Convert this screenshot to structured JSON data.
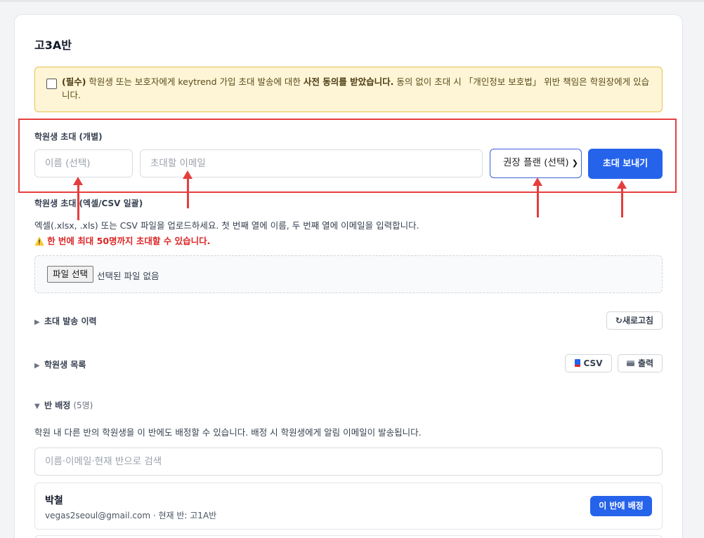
{
  "page": {
    "title": "고3A반"
  },
  "consent": {
    "checked": false,
    "required_tag": "(필수)",
    "text_a": " 학원생 또는 보호자에게 keytrend 가입 초대 발송에 대한 ",
    "text_bold": "사전 동의를 받았습니다.",
    "text_b": " 동의 없이 초대 시 「개인정보 보호법」 위반 책임은 학원장에게 있습니다."
  },
  "invite_single": {
    "label": "학원생 초대 (개별)",
    "name_placeholder": "이름 (선택)",
    "email_placeholder": "초대할 이메일",
    "plan_select_value": "권장 플랜 (선택)",
    "send_button": "초대 보내기"
  },
  "invite_bulk": {
    "label": "학원생 초대 (엑셀/CSV 일괄)",
    "description": "엑셀(.xlsx, .xls) 또는 CSV 파일을 업로드하세요. 첫 번째 열에 이름, 두 번째 열에 이메일을 입력합니다.",
    "warning_icon": "⚠️",
    "warning": "한 번에 최대 50명까지 초대할 수 있습니다.",
    "file_button": "파일 선택",
    "file_status": "선택된 파일 없음"
  },
  "history": {
    "label": "초대 발송 이력",
    "expanded": false,
    "refresh_button": "새로고침",
    "refresh_icon": "↻"
  },
  "students": {
    "label": "학원생 목록",
    "expanded": false,
    "csv_button": "CSV",
    "print_button": "출력"
  },
  "class_assign": {
    "label": "반 배정",
    "count": "(5명)",
    "expanded": true,
    "description": "학원 내 다른 반의 학원생을 이 반에도 배정할 수 있습니다. 배정 시 학원생에게 알림 이메일이 발송됩니다.",
    "search_placeholder": "이름·이메일·현재 반으로 검색",
    "items": [
      {
        "name": "박철",
        "detail": "vegas2seoul@gmail.com · 현재 반: 고1A반",
        "button": "이 반에 배정"
      }
    ]
  },
  "colors": {
    "primary": "#2563eb",
    "annotation": "#e53e3e",
    "consent_bg": "#fef5d6",
    "consent_border": "#e8c44f"
  }
}
